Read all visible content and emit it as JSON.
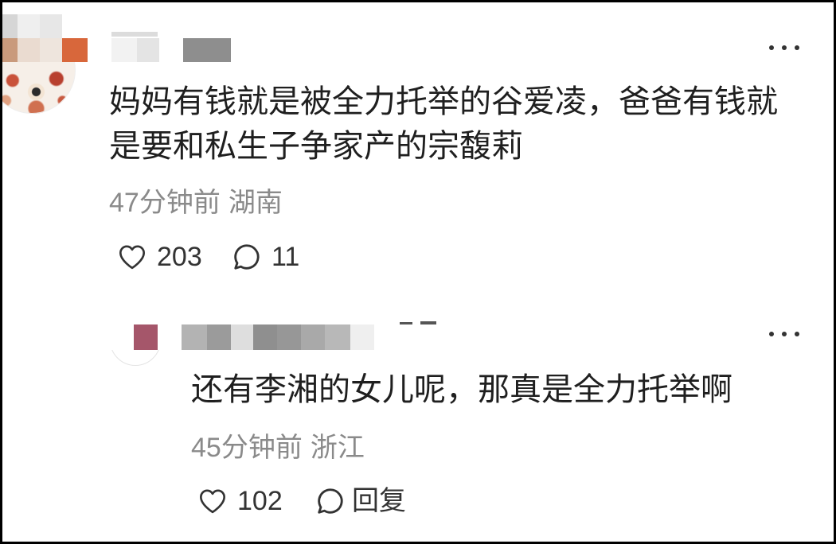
{
  "colors": {
    "text": "#1f1f1f",
    "meta": "#8a8a8a",
    "icon": "#333333",
    "background": "#ffffff",
    "border": "#000000"
  },
  "comment": {
    "avatar_icon": "avatar-redacted",
    "more_icon": "more-horizontal-icon",
    "text": "妈妈有钱就是被全力托举的谷爱凌，爸爸有钱就是要和私生子争家产的宗馥莉",
    "time": "47分钟前",
    "location": "湖南",
    "like_icon": "heart-outline-icon",
    "like_count": "203",
    "comment_icon": "comment-bubble-icon",
    "reply_count": "11"
  },
  "reply": {
    "avatar_icon": "avatar-redacted",
    "more_icon": "more-horizontal-icon",
    "text": "还有李湘的女儿呢，那真是全力托举啊",
    "time": "45分钟前",
    "location": "浙江",
    "like_icon": "heart-outline-icon",
    "like_count": "102",
    "comment_icon": "comment-bubble-icon",
    "reply_label": "回复"
  }
}
